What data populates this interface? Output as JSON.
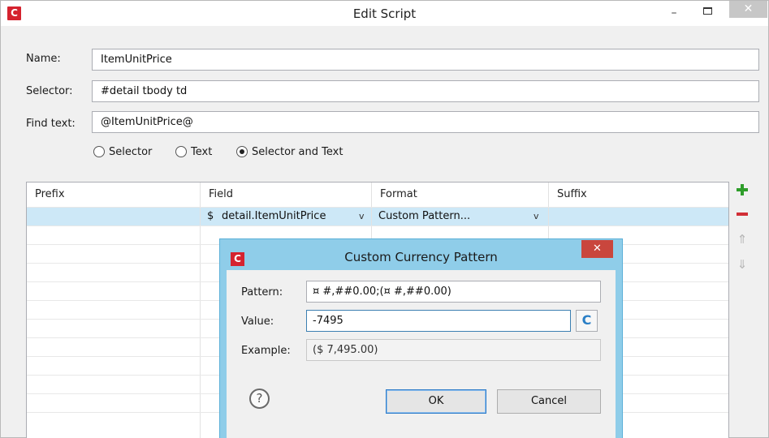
{
  "window": {
    "title": "Edit Script",
    "logo_letter": "C",
    "minimize_glyph": "–",
    "close_glyph": "✕"
  },
  "form": {
    "name_label": "Name:",
    "name_value": "ItemUnitPrice",
    "selector_label": "Selector:",
    "selector_value": "#detail tbody td",
    "find_label": "Find text:",
    "find_value": "@ItemUnitPrice@"
  },
  "radios": [
    {
      "label": "Selector",
      "checked": false
    },
    {
      "label": "Text",
      "checked": false
    },
    {
      "label": "Selector and Text",
      "checked": true
    }
  ],
  "table": {
    "columns": [
      "Prefix",
      "Field",
      "Format",
      "Suffix"
    ],
    "rows": [
      {
        "prefix": "",
        "field_marker": "$",
        "field": "detail.ItemUnitPrice",
        "format": "Custom Pattern...",
        "suffix": ""
      }
    ]
  },
  "tools": {
    "up_glyph": "⇑",
    "down_glyph": "⇓"
  },
  "dialog": {
    "title": "Custom Currency Pattern",
    "logo_letter": "C",
    "close_glyph": "✕",
    "pattern_label": "Pattern:",
    "pattern_value": "¤ #,##0.00;(¤ #,##0.00)",
    "value_label": "Value:",
    "value_value": "-7495",
    "example_label": "Example:",
    "example_value": "($ 7,495.00)",
    "refresh_glyph": "C",
    "help_glyph": "?",
    "ok_label": "OK",
    "cancel_label": "Cancel"
  },
  "colors": {
    "accent": "#d5232f",
    "selection": "#cde8f7",
    "dialog_frame": "#8fcde9",
    "add": "#2e9d2a",
    "remove": "#d12e36"
  },
  "chevron_glyph": "v"
}
